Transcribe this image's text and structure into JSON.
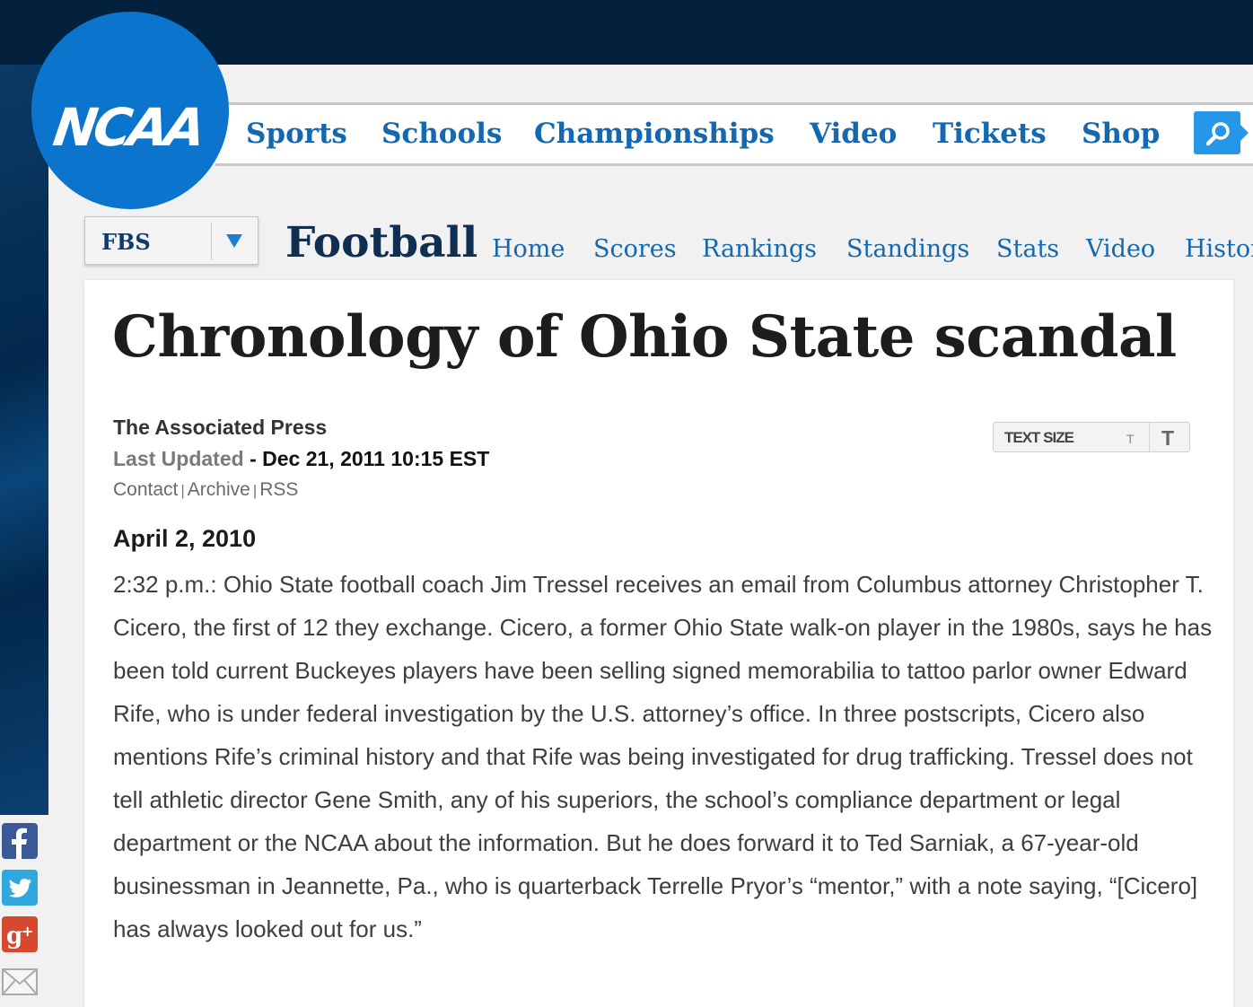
{
  "site": {
    "logo_text": "NCAA",
    "main_nav": [
      "Sports",
      "Schools",
      "Championships",
      "Video",
      "Tickets",
      "Shop"
    ],
    "search_icon": "search-icon"
  },
  "section": {
    "division_selected": "FBS",
    "sport_title": "Football",
    "sub_nav": [
      "Home",
      "Scores",
      "Rankings",
      "Standings",
      "Stats",
      "Video",
      "History"
    ]
  },
  "article": {
    "headline": "Chronology of Ohio State scandal",
    "byline": "The Associated Press",
    "updated_label": "Last Updated",
    "updated_value": " - Dec 21, 2011 10:15 EST",
    "links": [
      "Contact",
      "Archive",
      "RSS"
    ],
    "text_size_label": "TEXT SIZE",
    "text_size_small": "T",
    "text_size_large": "T",
    "entry_date": "April 2, 2010",
    "entry_body": "2:32 p.m.: Ohio State football coach Jim Tressel receives an email from Columbus attorney Christopher T. Cicero, the first of 12 they exchange. Cicero, a former Ohio State walk-on player in the 1980s, says he has been told current Buckeyes players have been selling signed memorabilia to tattoo parlor owner Edward Rife, who is under federal investigation by the U.S. attorney’s office. In three postscripts, Cicero also mentions Rife’s criminal history and that Rife was being investigated for drug trafficking. Tressel does not tell athletic director Gene Smith, any of his superiors, the school’s compliance department or legal department or the NCAA about the information. But he does forward it to Ted Sarniak, a 67-year-old businessman in Jeannette, Pa., who is quarterback Terrelle Pryor’s “mentor,” with a note saying, “[Cicero] has always looked out for us.”"
  },
  "share_icons": [
    "facebook-icon",
    "twitter-icon",
    "google-plus-icon",
    "email-icon"
  ],
  "colors": {
    "nav_blue": "#1468b0",
    "logo_blue": "#0b74cc",
    "top_band": "#03203d",
    "search_blue": "#2596e8"
  }
}
